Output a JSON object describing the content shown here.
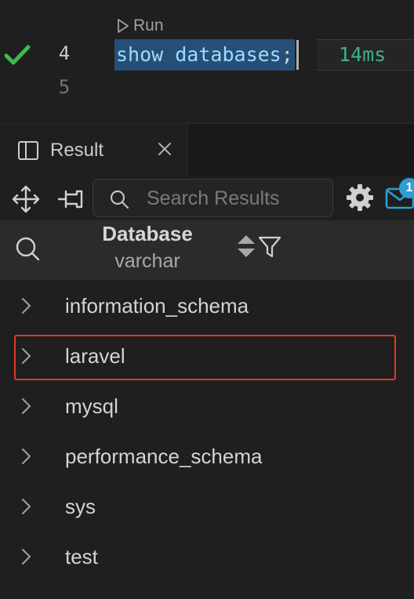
{
  "editor": {
    "codelens_label": "Run",
    "active_line_number": "4",
    "next_line_number": "5",
    "code_text": "show databases",
    "code_semicolon": ";",
    "timing": "14ms",
    "status_icon": "check-icon",
    "status_color": "#3fb950"
  },
  "panel": {
    "tab_label": "Result"
  },
  "toolbar": {
    "search_placeholder": "Search Results",
    "notification_count": "1"
  },
  "grid": {
    "column_name": "Database",
    "column_type": "varchar",
    "rows": [
      {
        "value": "information_schema"
      },
      {
        "value": "laravel",
        "highlighted": true
      },
      {
        "value": "mysql"
      },
      {
        "value": "performance_schema"
      },
      {
        "value": "sys"
      },
      {
        "value": "test"
      }
    ]
  },
  "colors": {
    "highlight_border": "#e0382a",
    "badge": "#2f9cd6",
    "timing_text": "#3fb08a",
    "selection": "#264f78"
  }
}
